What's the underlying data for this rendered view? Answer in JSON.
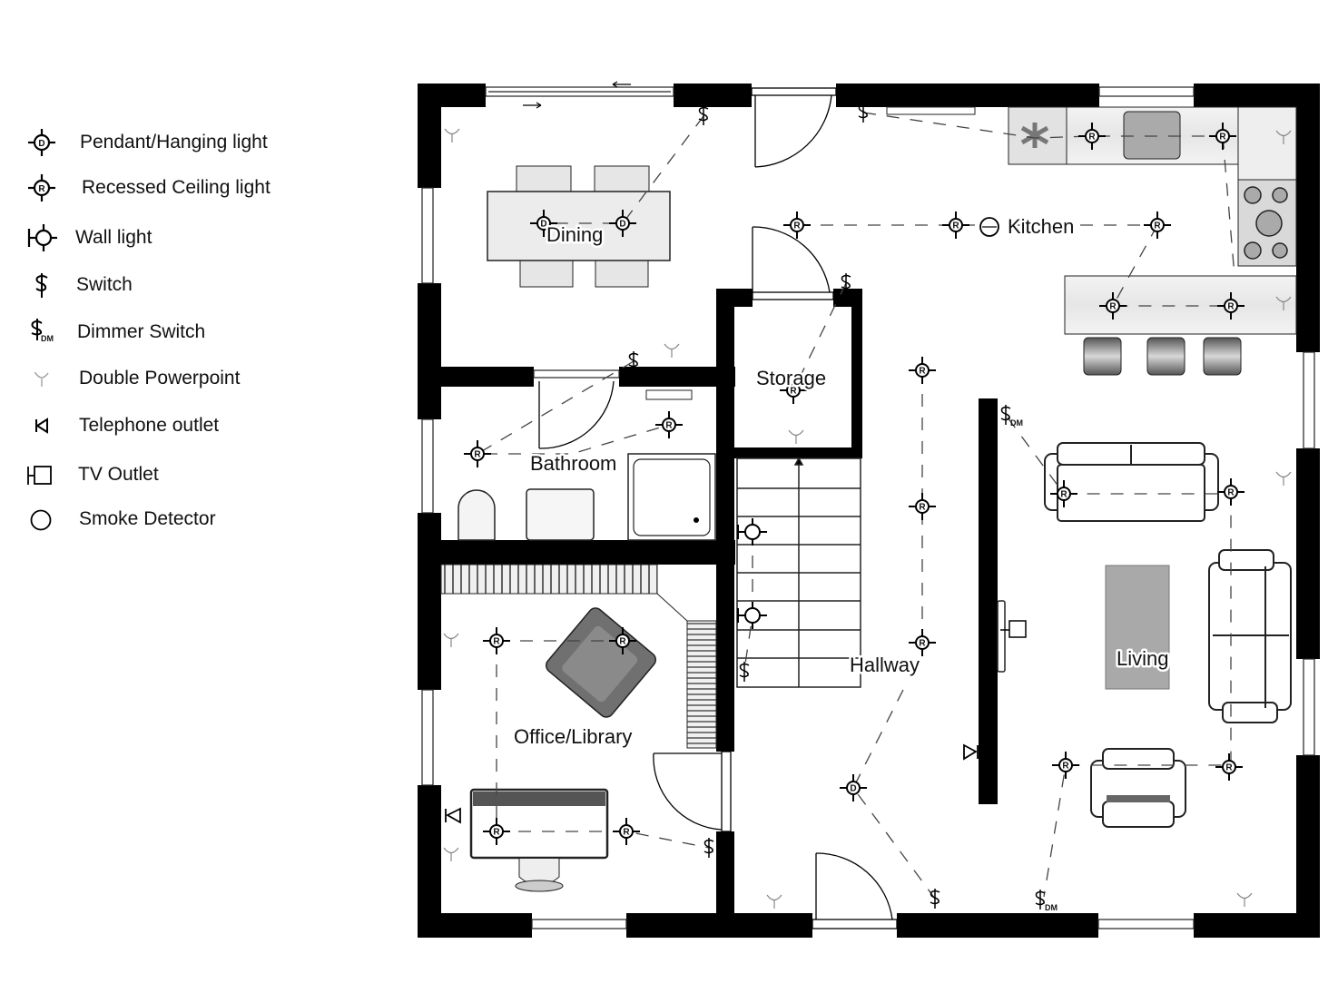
{
  "legend": {
    "items": [
      {
        "icon": "pendant-light-icon",
        "label": "Pendant/Hanging light"
      },
      {
        "icon": "recessed-light-icon",
        "label": "Recessed Ceiling light"
      },
      {
        "icon": "wall-light-icon",
        "label": "Wall light"
      },
      {
        "icon": "switch-icon",
        "label": "Switch"
      },
      {
        "icon": "dimmer-switch-icon",
        "label": "Dimmer Switch"
      },
      {
        "icon": "double-powerpoint-icon",
        "label": "Double Powerpoint"
      },
      {
        "icon": "telephone-outlet-icon",
        "label": "Telephone outlet"
      },
      {
        "icon": "tv-outlet-icon",
        "label": "TV Outlet"
      },
      {
        "icon": "smoke-detector-icon",
        "label": "Smoke Detector"
      }
    ]
  },
  "symbols": {
    "pendant_letter": "D",
    "recessed_letter": "R",
    "dimmer_suffix": "DM"
  },
  "rooms": {
    "dining": "Dining",
    "kitchen": "Kitchen",
    "storage": "Storage",
    "bathroom": "Bathroom",
    "office": "Office/Library",
    "hallway": "Hallway",
    "living": "Living"
  },
  "colors": {
    "wall": "#000000",
    "background": "#ffffff",
    "furniture_fill": "#e8e8e8",
    "furniture_dark": "#7a7a7a",
    "wiring": "#444444"
  }
}
